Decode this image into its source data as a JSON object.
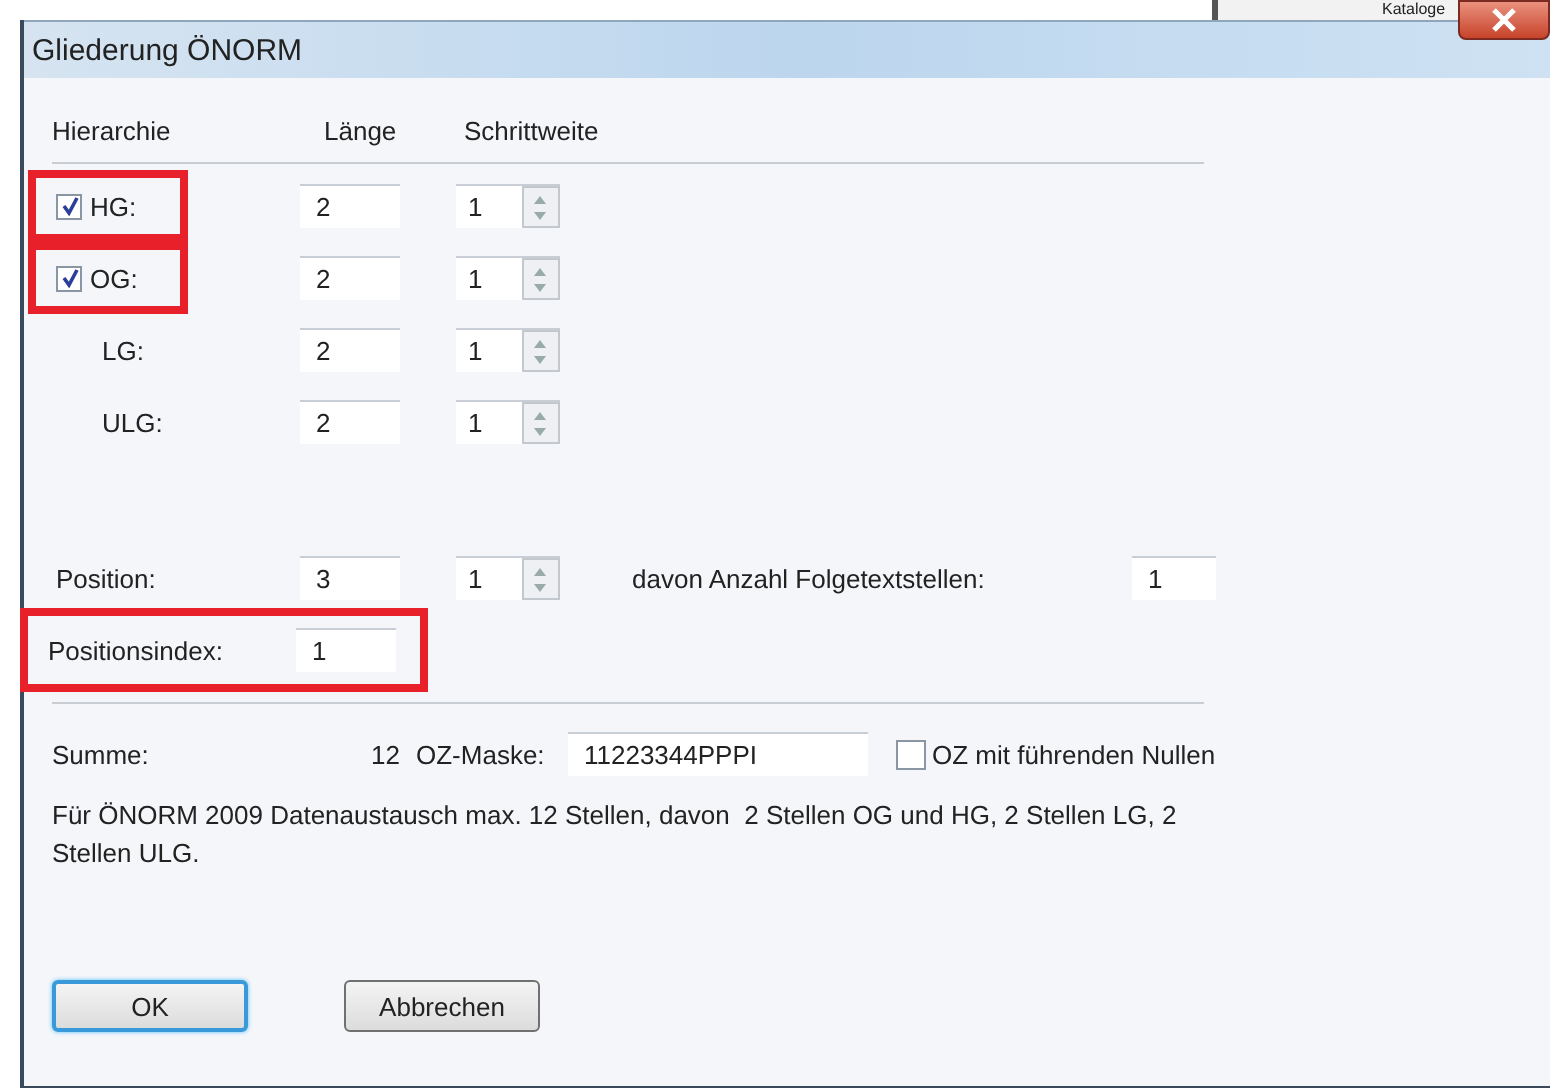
{
  "background_window": {
    "tree_item": "Kataloge"
  },
  "window": {
    "title": "Gliederung ÖNORM"
  },
  "columns": [
    "Hierarchie",
    "Länge",
    "Schrittweite"
  ],
  "levels": [
    {
      "kind": "checkbox",
      "label": "HG:",
      "checked": true,
      "length": "2",
      "step": "1",
      "highlighted": true
    },
    {
      "kind": "checkbox",
      "label": "OG:",
      "checked": true,
      "length": "2",
      "step": "1",
      "highlighted": true
    },
    {
      "kind": "plain",
      "label": "LG:",
      "length": "2",
      "step": "1",
      "highlighted": false
    },
    {
      "kind": "plain",
      "label": "ULG:",
      "length": "2",
      "step": "1",
      "highlighted": false
    }
  ],
  "position": {
    "label": "Position:",
    "length": "3",
    "step": "1",
    "followup_label": "davon Anzahl Folgetextstellen:",
    "followup_value": "1"
  },
  "position_index": {
    "label": "Positionsindex:",
    "value": "1",
    "highlighted": true
  },
  "sum": {
    "label": "Summe:",
    "value": "12",
    "mask_label": "OZ-Maske:",
    "mask_value": "11223344PPPI",
    "leading_zeros": {
      "label": "OZ mit führenden Nullen",
      "checked": false
    }
  },
  "note": "Für ÖNORM 2009 Datenaustausch max. 12 Stellen, davon  2 Stellen OG und HG, 2 Stellen LG, 2 Stellen ULG.",
  "buttons": [
    {
      "label": "OK",
      "default": true
    },
    {
      "label": "Abbrechen",
      "default": false
    }
  ]
}
